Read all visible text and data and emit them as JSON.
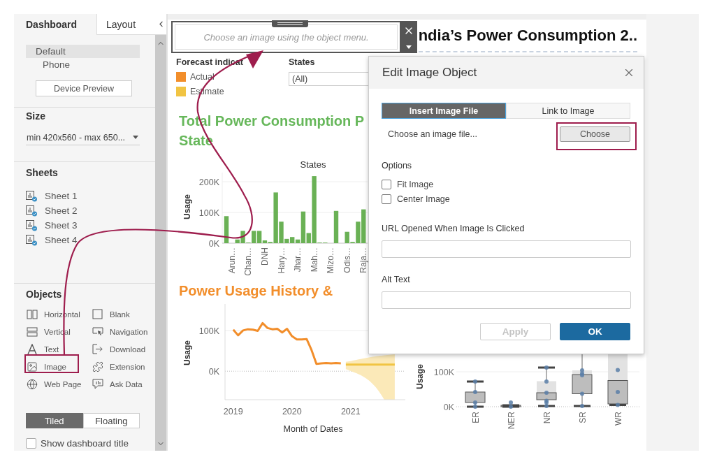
{
  "sidebar": {
    "tabs": [
      {
        "label": "Dashboard",
        "selected": true
      },
      {
        "label": "Layout",
        "selected": false
      }
    ],
    "devices": [
      {
        "label": "Default",
        "selected": true,
        "children": [
          {
            "label": "Phone",
            "selected": false
          }
        ]
      }
    ],
    "device_preview_button": "Device Preview",
    "size": {
      "heading": "Size",
      "value": "min 420x560 - max 650..."
    },
    "sheets": {
      "heading": "Sheets",
      "items": [
        "Sheet 1",
        "Sheet 2",
        "Sheet 3",
        "Sheet 4"
      ]
    },
    "objects": {
      "heading": "Objects",
      "items": [
        {
          "label": "Horizontal",
          "kind": "horizontal"
        },
        {
          "label": "Blank",
          "kind": "blank"
        },
        {
          "label": "Vertical",
          "kind": "vertical"
        },
        {
          "label": "Navigation",
          "kind": "navigation"
        },
        {
          "label": "Text",
          "kind": "text"
        },
        {
          "label": "Download",
          "kind": "download"
        },
        {
          "label": "Image",
          "kind": "image"
        },
        {
          "label": "Extension",
          "kind": "extension"
        },
        {
          "label": "Web Page",
          "kind": "webpage"
        },
        {
          "label": "Ask Data",
          "kind": "askdata"
        }
      ]
    },
    "layout_mode": [
      {
        "label": "Tiled",
        "selected": true
      },
      {
        "label": "Floating",
        "selected": false
      }
    ],
    "show_title": {
      "label": "Show dashboard title",
      "checked": false
    }
  },
  "canvas": {
    "image_object": {
      "placeholder": "Choose an image using the object menu."
    },
    "title": "ndia’s Power Consumption 2..",
    "legend": {
      "title": "Forecast indicat",
      "items": [
        {
          "label": "Actual",
          "color": "#f28e2b"
        },
        {
          "label": "Estimate",
          "color": "#f1c443"
        }
      ]
    },
    "states_filter": {
      "label": "States",
      "value": "(All)"
    },
    "bar_chart": {
      "title_lines": [
        "Total Power Consumption P",
        "State"
      ],
      "chart_data": {
        "type": "bar",
        "xlabel": "States",
        "ylabel": "Usage",
        "categories": [
          null,
          "Arun…",
          null,
          null,
          "Chan…",
          null,
          null,
          "DNH",
          null,
          null,
          "Hary…",
          null,
          null,
          "Jhar…",
          null,
          null,
          "Mah…",
          null,
          null,
          "Mizo…",
          null,
          null,
          "Odis…",
          null,
          null,
          "Raja…"
        ],
        "values": [
          88,
          0,
          12,
          40,
          2,
          40,
          40,
          9,
          4,
          165,
          70,
          14,
          20,
          12,
          103,
          33,
          218,
          2,
          2,
          0,
          105,
          0,
          37,
          4,
          70,
          110
        ],
        "ylim": [
          0,
          230
        ],
        "yticks": [
          {
            "value": 0,
            "label": "0K"
          },
          {
            "value": 100,
            "label": "100K"
          },
          {
            "value": 200,
            "label": "200K"
          }
        ]
      }
    },
    "line_chart": {
      "title": "Power Usage History &",
      "chart_data": {
        "type": "line",
        "xlabel": "Month of Dates",
        "ylabel": "Usage",
        "x": [
          2019,
          2019.083,
          2019.167,
          2019.25,
          2019.333,
          2019.417,
          2019.5,
          2019.583,
          2019.667,
          2019.75,
          2019.833,
          2019.917,
          2020,
          2020.083,
          2020.167,
          2020.25,
          2020.333,
          2020.417,
          2020.5,
          2020.583,
          2020.667,
          2020.75,
          2020.833,
          2020.917,
          2021,
          2021.083,
          2021.167,
          2021.25,
          2021.333,
          2021.417,
          2021.5,
          2021.583,
          2021.667,
          2021.75
        ],
        "series": [
          {
            "color": "#f28e2b",
            "values": [
              102,
              88,
              100,
              103,
              102,
              99,
              118,
              106,
              103,
              104,
              95,
              104,
              86,
              78,
              78,
              79,
              52,
              18,
              19,
              20,
              19,
              20,
              19,
              null,
              null,
              null,
              null,
              null,
              null,
              null,
              null,
              null,
              null,
              null
            ]
          },
          {
            "color": "#f1c443",
            "values": [
              null,
              null,
              null,
              null,
              null,
              null,
              null,
              null,
              null,
              null,
              null,
              null,
              null,
              null,
              null,
              null,
              null,
              null,
              null,
              null,
              null,
              null,
              null,
              16,
              16,
              16,
              16,
              16,
              16,
              16,
              16,
              16,
              16,
              16
            ]
          }
        ],
        "xlim": [
          2018.86,
          2021.93
        ],
        "ylim": [
          -70,
          165
        ],
        "xticks": [
          2019,
          2020,
          2021
        ],
        "yticks": [
          {
            "value": 0,
            "label": "0K"
          },
          {
            "value": 100,
            "label": "100K"
          }
        ]
      }
    },
    "box_chart": {
      "ylabel": "Usage",
      "yticks": [
        "100K",
        "0K"
      ],
      "categories": [
        "ER",
        "NER",
        "NR",
        "SR",
        "WR"
      ]
    }
  },
  "dialog": {
    "title": "Edit Image Object",
    "tabs": [
      {
        "label": "Insert Image File",
        "selected": true
      },
      {
        "label": "Link to Image",
        "selected": false
      }
    ],
    "file_prompt": "Choose an image file...",
    "choose_button": "Choose",
    "options_heading": "Options",
    "options": [
      {
        "label": "Fit Image",
        "checked": false
      },
      {
        "label": "Center Image",
        "checked": false
      }
    ],
    "url_label": "URL Opened When Image Is Clicked",
    "alt_label": "Alt Text",
    "buttons": [
      {
        "label": "Apply",
        "kind": "secondary",
        "disabled": true
      },
      {
        "label": "OK",
        "kind": "primary",
        "disabled": false
      }
    ]
  }
}
